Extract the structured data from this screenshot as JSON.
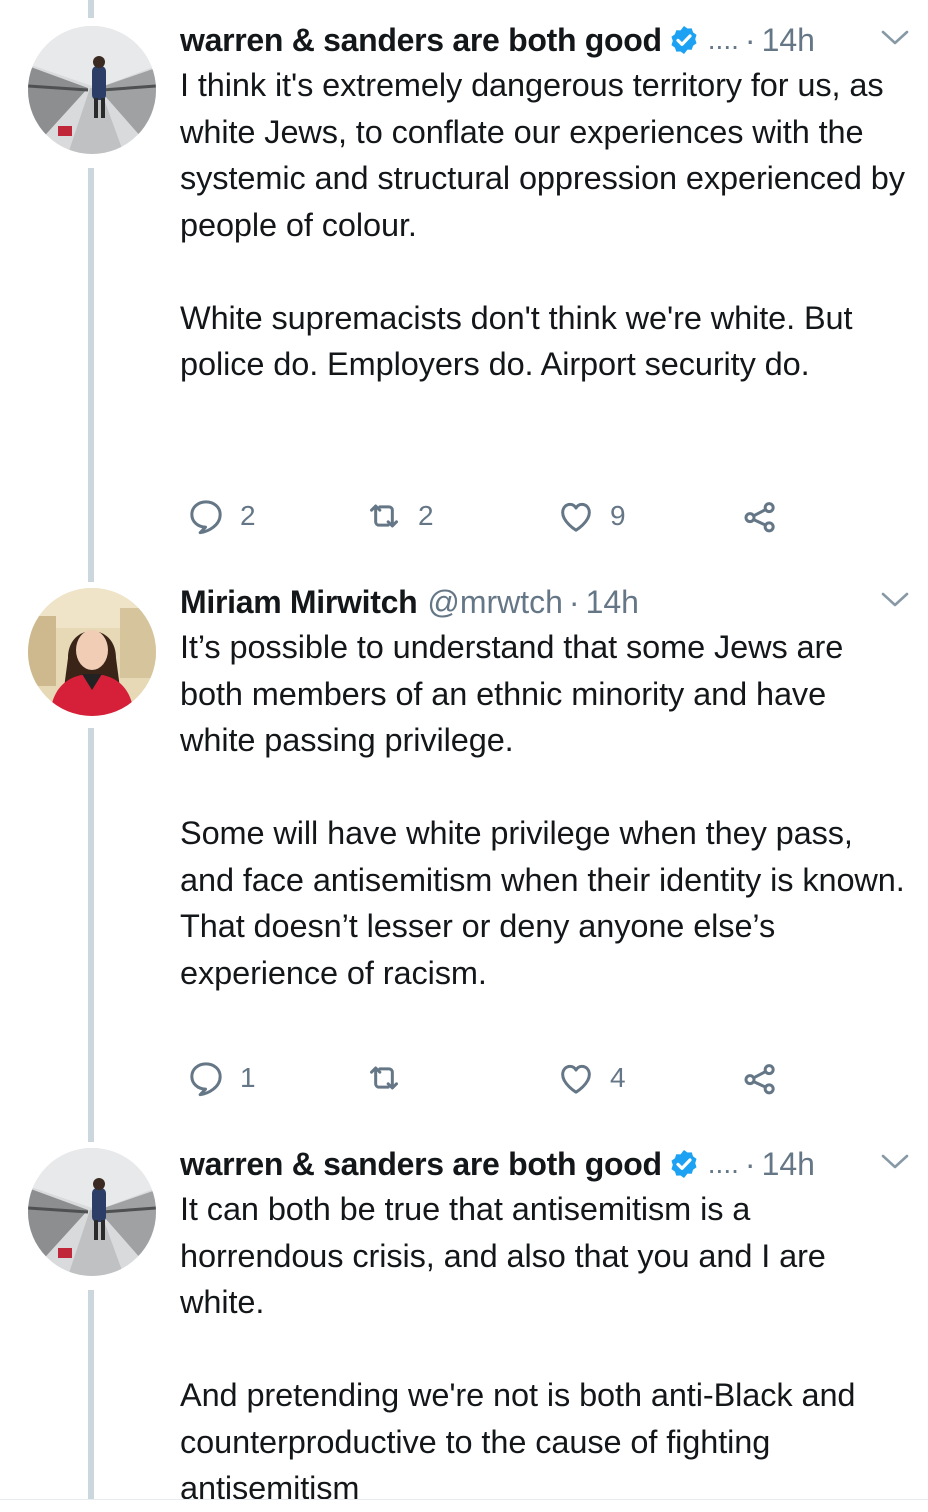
{
  "colors": {
    "thread_line": "#ccd6dd",
    "secondary_text": "#657786",
    "verified_badge": "#1da1f2",
    "primary_text": "#14171a"
  },
  "tweets": [
    {
      "display_name": "warren & sanders are both good",
      "verified": true,
      "ellipsis": "....",
      "handle": "",
      "time_sep": "·",
      "time": "14h",
      "paragraphs": [
        "I think it's extremely dangerous territory for us, as white Jews, to conflate our experiences with the systemic and structural oppression experienced by people of colour.",
        "White supremacists don't think we're white. But police do. Employers do. Airport security do."
      ],
      "replies": "2",
      "retweets": "2",
      "likes": "9"
    },
    {
      "display_name": "Miriam Mirwitch",
      "verified": false,
      "handle": "@mrwtch",
      "time_sep": "·",
      "time": "14h",
      "paragraphs": [
        "It’s possible to understand that some Jews are both members of an ethnic minority and have white passing privilege.",
        "Some will have white privilege when they pass, and face antisemitism when their identity is known. That doesn’t lesser or deny anyone else’s experience of racism."
      ],
      "replies": "1",
      "retweets": "",
      "likes": "4"
    },
    {
      "display_name": "warren & sanders are both good",
      "verified": true,
      "ellipsis": "....",
      "handle": "",
      "time_sep": "·",
      "time": "14h",
      "paragraphs": [
        "It can both be true that antisemitism is a horrendous crisis, and also that you and I are white.",
        "And pretending we're not is both anti-Black and counterproductive to the cause of fighting antisemitism"
      ]
    }
  ]
}
